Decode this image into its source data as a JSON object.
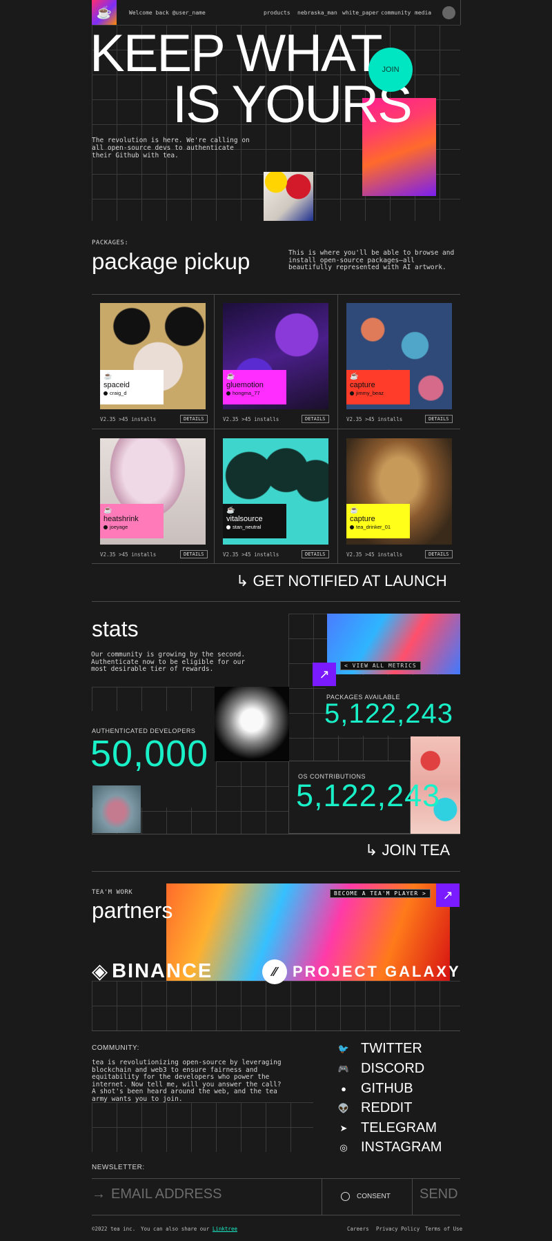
{
  "header": {
    "welcome": "Welcome back @user_name",
    "nav": [
      "products",
      "nebraska_man",
      "white_paper",
      "community",
      "media"
    ]
  },
  "hero": {
    "line1": "KEEP WHAT",
    "line2": "IS YOURS",
    "join": "JOIN",
    "text": "The revolution is here. We're calling on all open-source devs to authenticate their Github with tea."
  },
  "packages": {
    "label": "PACKAGES:",
    "title": "package pickup",
    "description": "This is where you'll be able to browse and install open-source packages—all beautifully represented with AI artwork.",
    "items": [
      {
        "name": "spaceid",
        "author": "craig_d",
        "meta": "V2.35 >45 installs",
        "details": "DETAILS",
        "tag_color": "#ffffff",
        "art": "#c9a96a"
      },
      {
        "name": "gluemotion",
        "author": "hongma_77",
        "meta": "V2.35 >45 installs",
        "details": "DETAILS",
        "tag_color": "#ff2dff",
        "art": "#3a1a6e"
      },
      {
        "name": "capture",
        "author": "jimmy_beaz",
        "meta": "V2.35 >45 installs",
        "details": "DETAILS",
        "tag_color": "#ff3b2a",
        "art": "#2a4a7a"
      },
      {
        "name": "heatshrink",
        "author": "joeyage",
        "meta": "V2.35 >45 installs",
        "details": "DETAILS",
        "tag_color": "#ff7ab8",
        "art": "#d8c9c6"
      },
      {
        "name": "vitalsource",
        "author": "stan_neutral",
        "meta": "V2.35 >45 installs",
        "details": "DETAILS",
        "tag_color": "#111111",
        "art": "#3ed6cc"
      },
      {
        "name": "capture",
        "author": "tea_drinker_01",
        "meta": "V2.35 >45 installs",
        "details": "DETAILS",
        "tag_color": "#ffff1a",
        "art": "#6a4a2a"
      }
    ],
    "cta": "GET NOTIFIED AT LAUNCH"
  },
  "stats": {
    "title": "stats",
    "text": "Our community is growing by the second. Authenticate now to be eligible for our most desirable tier of rewards.",
    "view_metrics": "< VIEW ALL METRICS",
    "packages_label": "PACKAGES AVAILABLE",
    "packages_value": "5,122,243",
    "devs_label": "AUTHENTICATED DEVELOPERS",
    "devs_value": "50,000",
    "contrib_label": "OS CONTRIBUTIONS",
    "contrib_value": "5,122,243",
    "cta": "JOIN TEA"
  },
  "partners": {
    "label": "TEA'M WORK",
    "title": "partners",
    "become": "BECOME A TEA'M PLAYER >",
    "logos": [
      "BINANCE",
      "PROJECT GALAXY"
    ]
  },
  "community": {
    "label": "COMMUNITY:",
    "text": "tea is revolutionizing open-source by leveraging blockchain and web3 to ensure fairness and equitability for the developers who power the internet. Now tell me, will you answer the call? A shot's been heard around the web, and the tea army wants you to join.",
    "socials": [
      {
        "label": "TWITTER",
        "icon": "twitter-icon"
      },
      {
        "label": "DISCORD",
        "icon": "discord-icon"
      },
      {
        "label": "GITHUB",
        "icon": "github-icon"
      },
      {
        "label": "REDDIT",
        "icon": "reddit-icon"
      },
      {
        "label": "TELEGRAM",
        "icon": "telegram-icon"
      },
      {
        "label": "INSTAGRAM",
        "icon": "instagram-icon"
      }
    ]
  },
  "newsletter": {
    "label": "NEWSLETTER:",
    "placeholder": "EMAIL ADDRESS",
    "consent": "CONSENT",
    "send": "SEND"
  },
  "footer": {
    "copyright": "©2022 tea inc.",
    "share_text": "You can also share our",
    "share_link": "Linktree",
    "links": [
      "Careers",
      "Privacy Policy",
      "Terms of Use"
    ]
  },
  "colors": {
    "background": "#1a1a1a",
    "accent_teal": "#19f0c8",
    "accent_purple": "#7a1bff",
    "join_badge": "#00e5c2"
  }
}
